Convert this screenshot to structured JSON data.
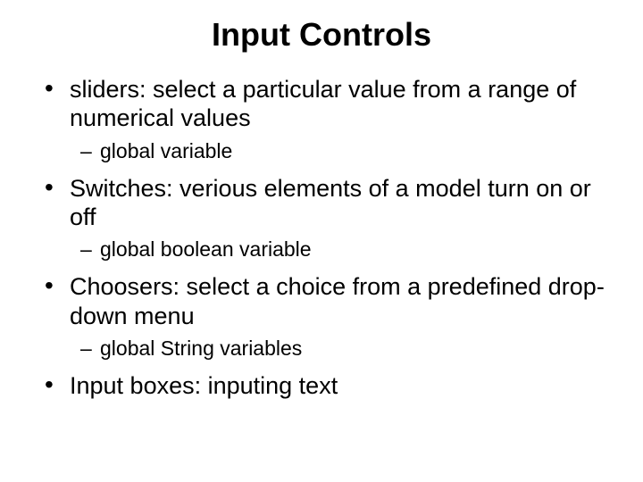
{
  "title": "Input Controls",
  "bullets": [
    {
      "text": "sliders: select a particular value from a range of numerical values",
      "sub": "global variable"
    },
    {
      "text": "Switches: verious elements of a model turn on or off",
      "sub": "global boolean variable"
    },
    {
      "text": "Choosers: select a choice from a predefined drop-down menu",
      "sub": "global String variables"
    },
    {
      "text": "Input boxes: inputing text",
      "sub": null
    }
  ]
}
